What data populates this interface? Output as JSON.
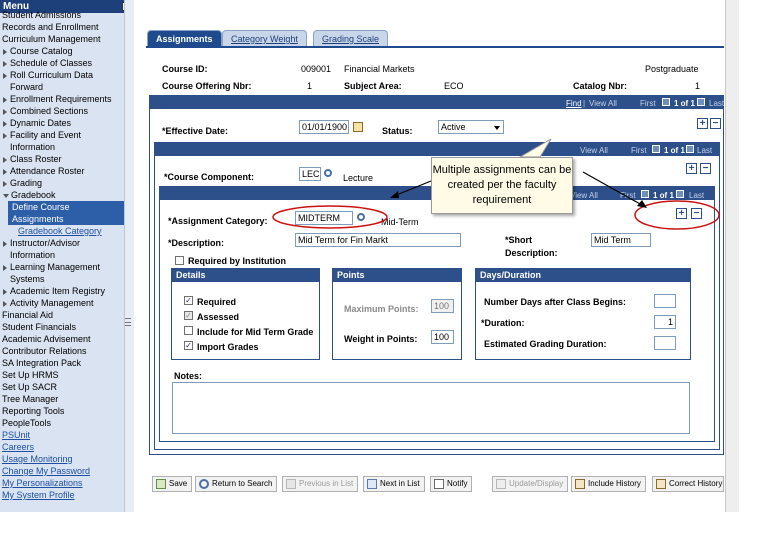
{
  "menu": {
    "title": "Menu",
    "items": [
      {
        "label": "Student Admissions",
        "kind": "l1"
      },
      {
        "label": "Records and Enrollment",
        "kind": "l1"
      },
      {
        "label": "Curriculum Management",
        "kind": "l1"
      },
      {
        "label": "Course Catalog",
        "kind": "l2"
      },
      {
        "label": "Schedule of Classes",
        "kind": "l2"
      },
      {
        "label": "Roll Curriculum Data",
        "kind": "l2"
      },
      {
        "label": "Forward",
        "kind": "cont"
      },
      {
        "label": "Enrollment Requirements",
        "kind": "l2"
      },
      {
        "label": "Combined Sections",
        "kind": "l2"
      },
      {
        "label": "Dynamic Dates",
        "kind": "l2"
      },
      {
        "label": "Facility and Event",
        "kind": "l2"
      },
      {
        "label": "Information",
        "kind": "cont"
      },
      {
        "label": "Class Roster",
        "kind": "l2"
      },
      {
        "label": "Attendance Roster",
        "kind": "l2"
      },
      {
        "label": "Grading",
        "kind": "l2"
      },
      {
        "label": "Gradebook",
        "kind": "l2open"
      },
      {
        "label": "Define Course",
        "kind": "sub"
      },
      {
        "label": "Assignments",
        "kind": "sub"
      },
      {
        "label": "Gradebook Category",
        "kind": "sublink"
      },
      {
        "label": "Instructor/Advisor",
        "kind": "l2"
      },
      {
        "label": "Information",
        "kind": "cont"
      },
      {
        "label": "Learning Management",
        "kind": "l2"
      },
      {
        "label": "Systems",
        "kind": "cont"
      },
      {
        "label": "Academic Item Registry",
        "kind": "l2"
      },
      {
        "label": "Activity Management",
        "kind": "l2"
      },
      {
        "label": "Financial Aid",
        "kind": "l1"
      },
      {
        "label": "Student Financials",
        "kind": "l1"
      },
      {
        "label": "Academic Advisement",
        "kind": "l1"
      },
      {
        "label": "Contributor Relations",
        "kind": "l1"
      },
      {
        "label": "SA Integration Pack",
        "kind": "l1"
      },
      {
        "label": "Set Up HRMS",
        "kind": "l1"
      },
      {
        "label": "Set Up SACR",
        "kind": "l1"
      },
      {
        "label": "Tree Manager",
        "kind": "l1"
      },
      {
        "label": "Reporting Tools",
        "kind": "l1"
      },
      {
        "label": "PeopleTools",
        "kind": "l1"
      },
      {
        "label": "PSUnit",
        "kind": "link"
      },
      {
        "label": "Careers",
        "kind": "link"
      },
      {
        "label": "Usage Monitoring",
        "kind": "link"
      },
      {
        "label": "Change My Password",
        "kind": "link"
      },
      {
        "label": "My Personalizations",
        "kind": "link"
      },
      {
        "label": "My System Profile",
        "kind": "link"
      }
    ]
  },
  "tabs": [
    {
      "label": "Assignments",
      "active": true
    },
    {
      "label": "Category Weight",
      "active": false
    },
    {
      "label": "Grading Scale",
      "active": false
    }
  ],
  "header": {
    "course_id_label": "Course ID:",
    "course_id": "009001",
    "course_title": "Financial Markets",
    "career": "Postgraduate",
    "offering_label": "Course Offering Nbr:",
    "offering": "1",
    "subject_label": "Subject Area:",
    "subject": "ECO",
    "catalog_label": "Catalog Nbr:",
    "catalog": "1"
  },
  "nav": {
    "find": "Find",
    "view_all": "View All",
    "first": "First",
    "last": "Last",
    "count": "1 of 1",
    "sep": "|"
  },
  "effdate": {
    "label": "*Effective Date:",
    "value": "01/01/1900",
    "status_label": "Status:",
    "status_value": "Active"
  },
  "component": {
    "label": "*Course Component:",
    "code": "LEC",
    "desc": "Lecture"
  },
  "assignment": {
    "category_label": "*Assignment Category:",
    "category_value": "MIDTERM",
    "category_desc": "Mid-Term",
    "description_label": "*Description:",
    "description_value": "Mid Term for Fin Markt",
    "short_label": "*Short",
    "short_label2": "Description:",
    "short_value": "Mid Term",
    "required_label": "Required by Institution"
  },
  "details": {
    "title": "Details",
    "required": "Required",
    "assessed": "Assessed",
    "include_mid": "Include for Mid Term Grade",
    "import": "Import Grades"
  },
  "points": {
    "title": "Points",
    "max_label": "Maximum Points:",
    "max_value": "100",
    "weight_label": "Weight in Points:",
    "weight_value": "100"
  },
  "duration": {
    "title": "Days/Duration",
    "days_label": "Number Days after Class Begins:",
    "days_value": "",
    "duration_label": "*Duration:",
    "duration_value": "1",
    "grading_label": "Estimated Grading Duration:",
    "grading_value": ""
  },
  "notes": {
    "label": "Notes:"
  },
  "toolbar": {
    "save": "Save",
    "return": "Return to Search",
    "prev": "Previous in List",
    "next": "Next in List",
    "notify": "Notify",
    "update": "Update/Display",
    "include_history": "Include History",
    "correct_history": "Correct History"
  },
  "callout": {
    "text": "Multiple assignments can be created per the faculty requirement"
  },
  "colors": {
    "bar": "#2d4f8a",
    "highlight_oval": "#cc1111",
    "menu_selected": "#2d5fa8"
  }
}
